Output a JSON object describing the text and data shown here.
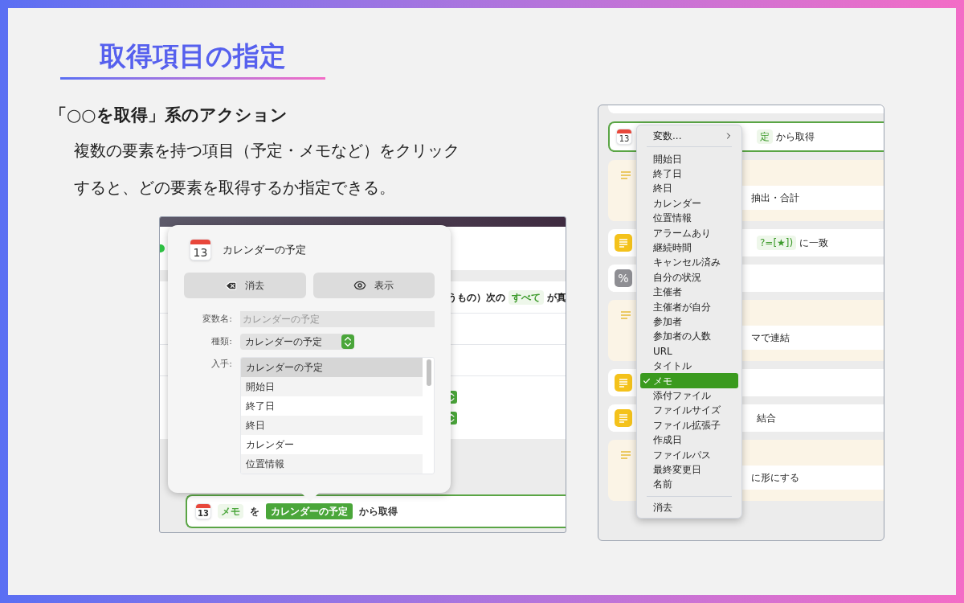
{
  "heading": "取得項目の指定",
  "subheading": "「○○を取得」系のアクション",
  "description": [
    "複数の要素を持つ項目（予定・メモなど）をクリック",
    "すると、どの要素を取得するか指定できる。"
  ],
  "left_screenshot": {
    "background_row": [
      {
        "text": "うもの）次の",
        "highlight": false
      },
      {
        "text": "すべて",
        "highlight": true
      },
      {
        "text": "が真",
        "highlight": false
      }
    ],
    "popover": {
      "icon_day": "13",
      "title": "カレンダーの予定",
      "buttons": [
        {
          "kind": "clear",
          "label": "消去"
        },
        {
          "kind": "show",
          "label": "表示"
        }
      ],
      "variable_name": {
        "label": "変数名:",
        "placeholder": "カレンダーの予定"
      },
      "type": {
        "label": "種類:",
        "value": "カレンダーの予定"
      },
      "source": {
        "label": "入手:",
        "items": [
          {
            "label": "カレンダーの予定",
            "selected": true
          },
          {
            "label": "開始日",
            "selected": false
          },
          {
            "label": "終了日",
            "selected": false
          },
          {
            "label": "終日",
            "selected": false
          },
          {
            "label": "カレンダー",
            "selected": false
          },
          {
            "label": "位置情報",
            "selected": false
          }
        ]
      }
    },
    "action": {
      "icon_day": "13",
      "item": "メモ",
      "particle": "を",
      "variable": "カレンダーの予定",
      "suffix": "から取得"
    }
  },
  "right_screenshot": {
    "rows": [
      {
        "kind": "calendar",
        "selected": true,
        "icon_day": "13",
        "segments": [
          {
            "text": "定",
            "highlight": true
          },
          {
            "text": "から取得",
            "highlight": false
          }
        ]
      },
      {
        "kind": "note",
        "selected": false,
        "segments": [
          {
            "text": "抽出・合計",
            "highlight": false
          }
        ]
      },
      {
        "kind": "text",
        "selected": false,
        "segments": [
          {
            "text": "?=[★])",
            "highlight": true
          },
          {
            "text": "に一致",
            "highlight": false
          }
        ]
      },
      {
        "kind": "percent",
        "selected": false,
        "icon_text": "%",
        "segments": []
      },
      {
        "kind": "note",
        "selected": false,
        "segments": [
          {
            "text": "マで連結",
            "highlight": false
          }
        ]
      },
      {
        "kind": "text",
        "selected": false,
        "segments": []
      },
      {
        "kind": "text",
        "selected": false,
        "segments": [
          {
            "text": "結合",
            "highlight": false
          }
        ]
      },
      {
        "kind": "note",
        "selected": false,
        "segments": [
          {
            "text": "に形にする",
            "highlight": false
          }
        ]
      }
    ],
    "menu": {
      "submenu_label": "変数...",
      "footer": "消去",
      "items": [
        {
          "label": "開始日",
          "selected": false
        },
        {
          "label": "終了日",
          "selected": false
        },
        {
          "label": "終日",
          "selected": false
        },
        {
          "label": "カレンダー",
          "selected": false
        },
        {
          "label": "位置情報",
          "selected": false
        },
        {
          "label": "アラームあり",
          "selected": false
        },
        {
          "label": "継続時間",
          "selected": false
        },
        {
          "label": "キャンセル済み",
          "selected": false
        },
        {
          "label": "自分の状況",
          "selected": false
        },
        {
          "label": "主催者",
          "selected": false
        },
        {
          "label": "主催者が自分",
          "selected": false
        },
        {
          "label": "参加者",
          "selected": false
        },
        {
          "label": "参加者の人数",
          "selected": false
        },
        {
          "label": "URL",
          "selected": false
        },
        {
          "label": "タイトル",
          "selected": false
        },
        {
          "label": "メモ",
          "selected": true
        },
        {
          "label": "添付ファイル",
          "selected": false
        },
        {
          "label": "ファイルサイズ",
          "selected": false
        },
        {
          "label": "ファイル拡張子",
          "selected": false
        },
        {
          "label": "作成日",
          "selected": false
        },
        {
          "label": "ファイルパス",
          "selected": false
        },
        {
          "label": "最終変更日",
          "selected": false
        },
        {
          "label": "名前",
          "selected": false
        }
      ]
    }
  }
}
